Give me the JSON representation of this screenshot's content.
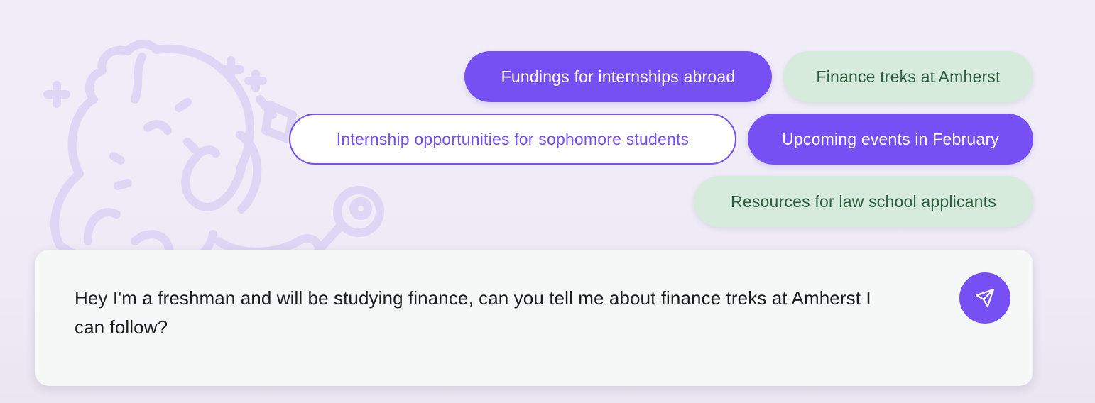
{
  "suggestions": [
    {
      "label": "Fundings for internships abroad",
      "style": "purple"
    },
    {
      "label": "Finance treks at Amherst",
      "style": "green"
    },
    {
      "label": "Internship opportunities for sophomore students",
      "style": "outline"
    },
    {
      "label": "Upcoming events in February",
      "style": "purple"
    },
    {
      "label": "Resources for law school applicants",
      "style": "green"
    }
  ],
  "composer": {
    "message": "Hey I'm a freshman and will be studying finance, can you tell me about finance treks at Amherst I can follow?",
    "send_icon": "send-icon"
  },
  "decor": {
    "mascot_icon": "mammoth-mascot-icon"
  },
  "colors": {
    "accent": "#7650f2",
    "chip_green_bg": "#d6ebdc",
    "chip_green_text": "#2e5e3f",
    "background": "#f1eef9",
    "composer_bg": "#f6f8f8",
    "mascot_stroke": "#ded6f5"
  }
}
